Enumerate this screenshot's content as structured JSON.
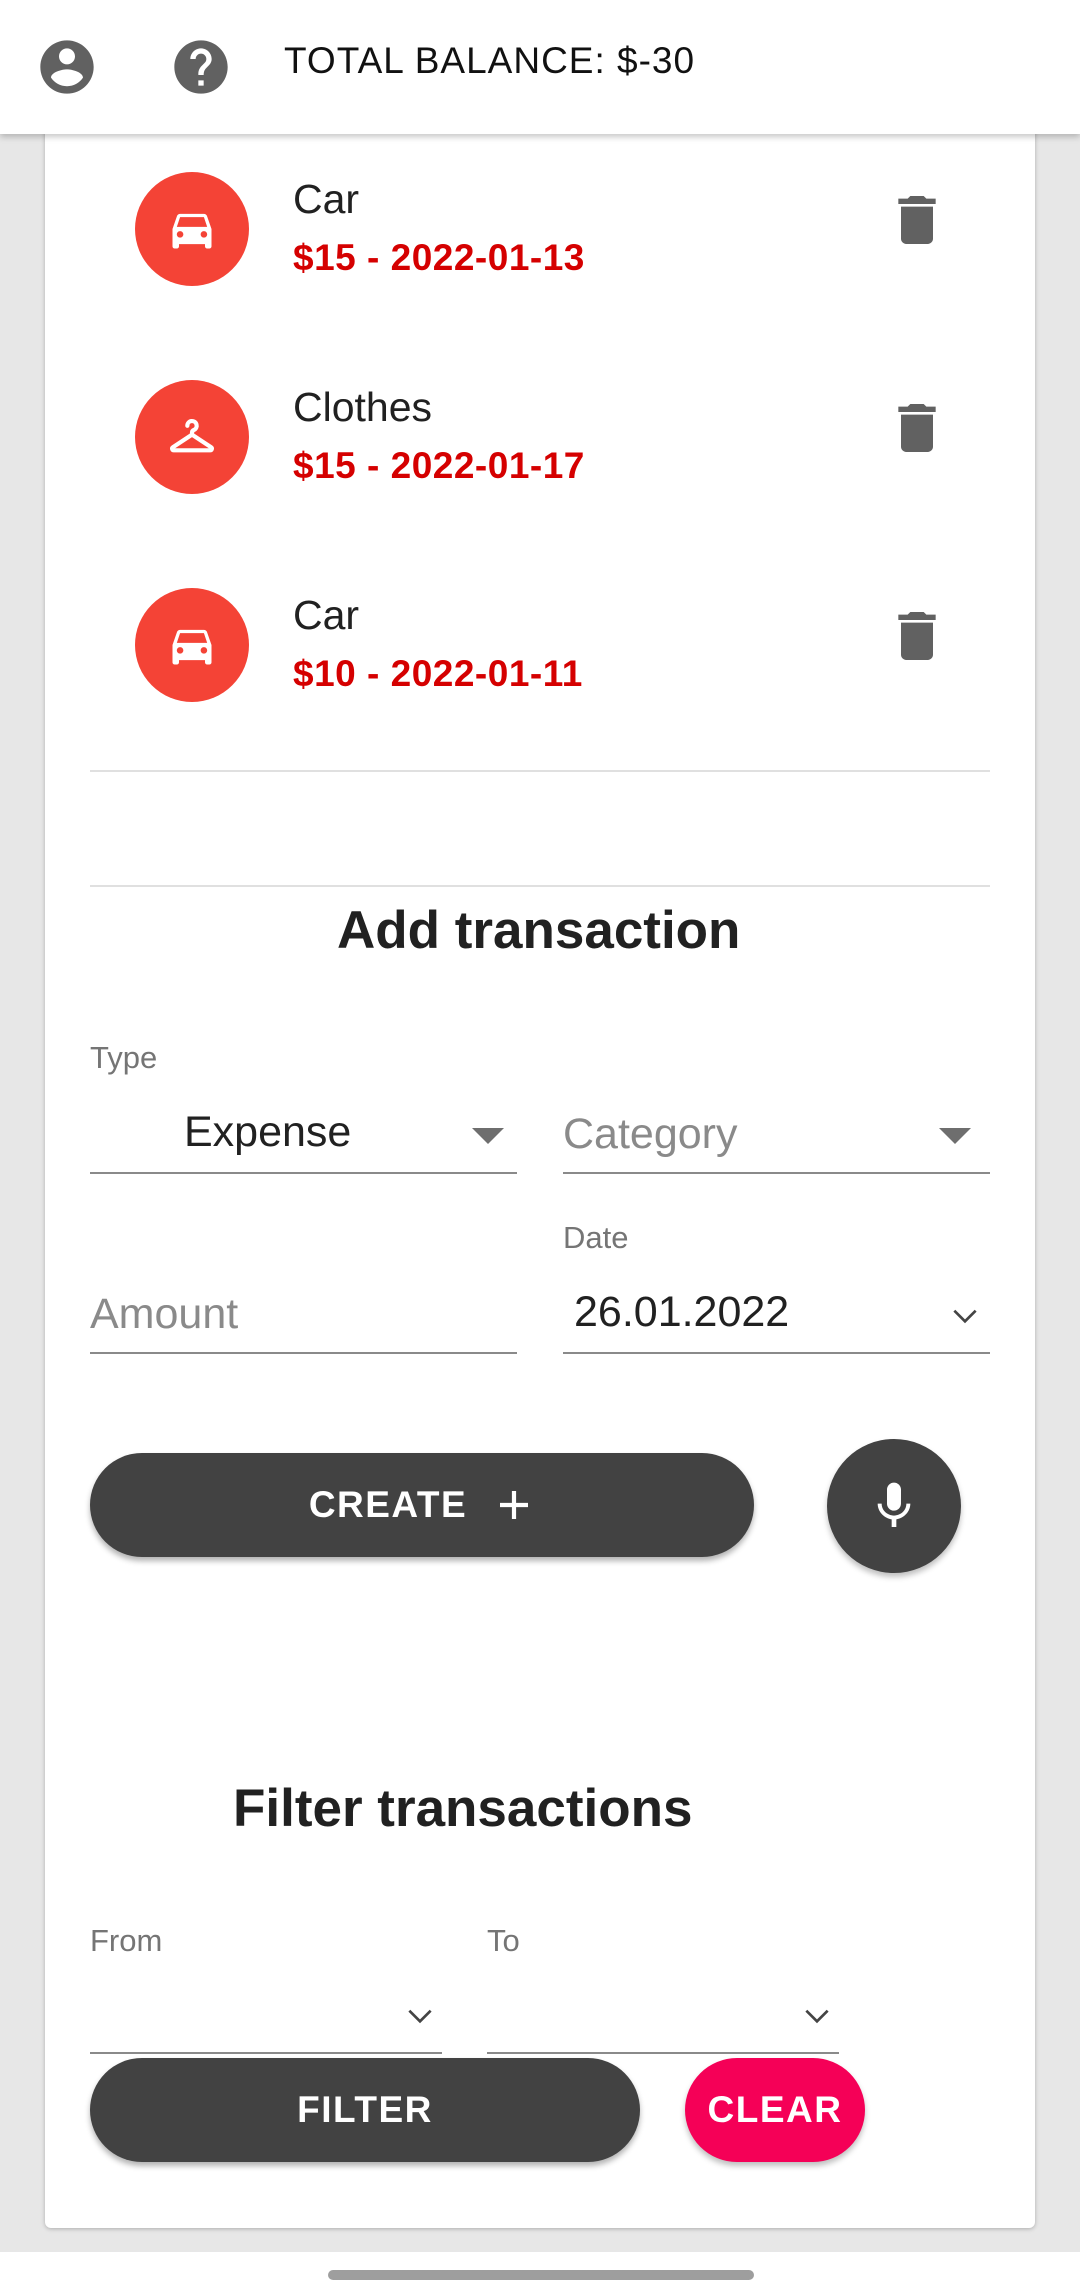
{
  "header": {
    "balance": "TOTAL BALANCE: $-30",
    "account_icon": "account-circle-icon",
    "help_icon": "help-circle-icon"
  },
  "transactions": [
    {
      "category": "Car",
      "detail": "$15 - 2022-01-13",
      "icon": "car-icon"
    },
    {
      "category": "Clothes",
      "detail": "$15 - 2022-01-17",
      "icon": "hanger-icon"
    },
    {
      "category": "Car",
      "detail": "$10 - 2022-01-11",
      "icon": "car-icon"
    }
  ],
  "add_transaction": {
    "title": "Add transaction",
    "type_label": "Type",
    "type_value": "Expense",
    "category_placeholder": "Category",
    "amount_placeholder": "Amount",
    "date_label": "Date",
    "date_value": "26.01.2022",
    "create_label": "CREATE"
  },
  "filter": {
    "title": "Filter transactions",
    "from_label": "From",
    "to_label": "To",
    "filter_label": "FILTER",
    "clear_label": "CLEAR"
  },
  "colors": {
    "accent_red": "#f44336",
    "amount_red": "#d50000",
    "dark_button": "#424242",
    "clear_pink": "#f50057"
  }
}
